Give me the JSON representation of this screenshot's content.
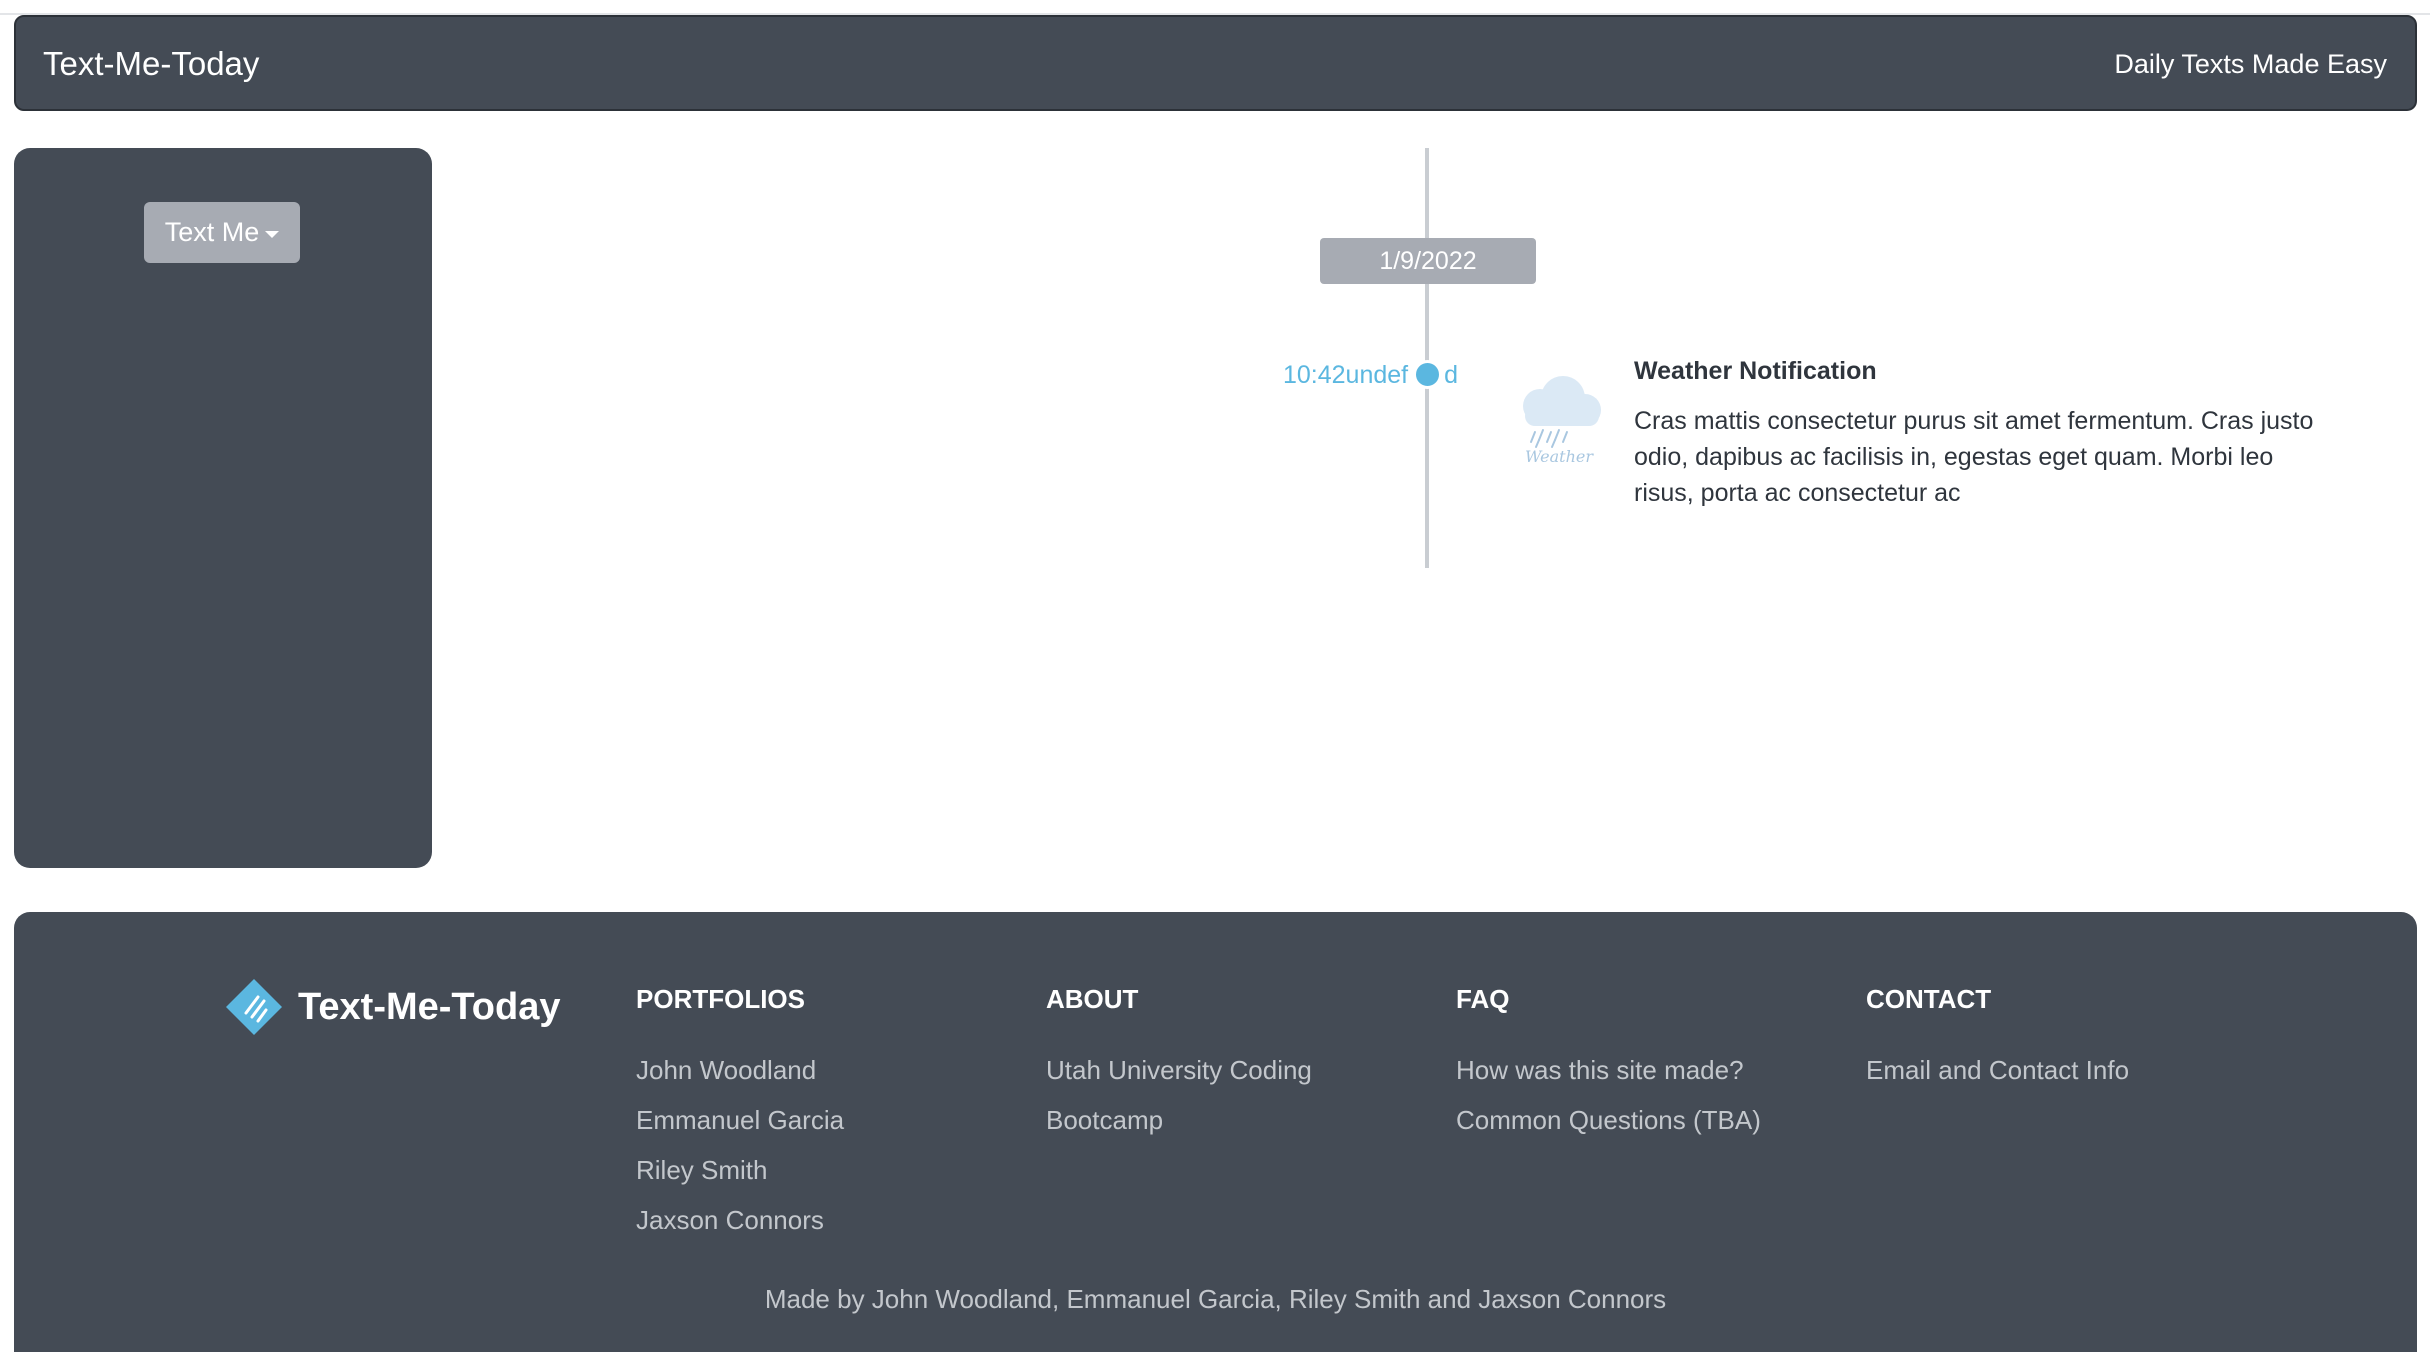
{
  "header": {
    "brand": "Text-Me-Today",
    "tagline": "Daily Texts Made Easy"
  },
  "sidebar": {
    "dropdown_label": "Text Me"
  },
  "timeline": {
    "date": "1/9/2022",
    "time": "10:42undef",
    "time_tail": "d",
    "notification": {
      "icon": "weather-rain-icon",
      "icon_caption": "Weather",
      "title": "Weather Notification",
      "body": "Cras mattis consectetur purus sit amet fermentum. Cras justo odio, dapibus ac facilisis in, egestas eget quam. Morbi leo risus, porta ac consectetur ac"
    }
  },
  "footer": {
    "logo_text": "Text-Me-Today",
    "columns": [
      {
        "title": "PORTFOLIOS",
        "links": [
          "John Woodland",
          "Emmanuel Garcia",
          "Riley Smith",
          "Jaxson Connors"
        ]
      },
      {
        "title": "ABOUT",
        "links": [
          "Utah University Coding",
          "Bootcamp"
        ]
      },
      {
        "title": "FAQ",
        "links": [
          "How was this site made?",
          "Common Questions (TBA)"
        ]
      },
      {
        "title": "CONTACT",
        "links": [
          "Email and Contact Info"
        ]
      }
    ],
    "credit": "Made by John Woodland, Emmanuel Garcia, Riley Smith and Jaxson Connors"
  },
  "colors": {
    "panel": "#444b55",
    "accent": "#5bb7e0",
    "muted_button": "#a7abb3"
  }
}
